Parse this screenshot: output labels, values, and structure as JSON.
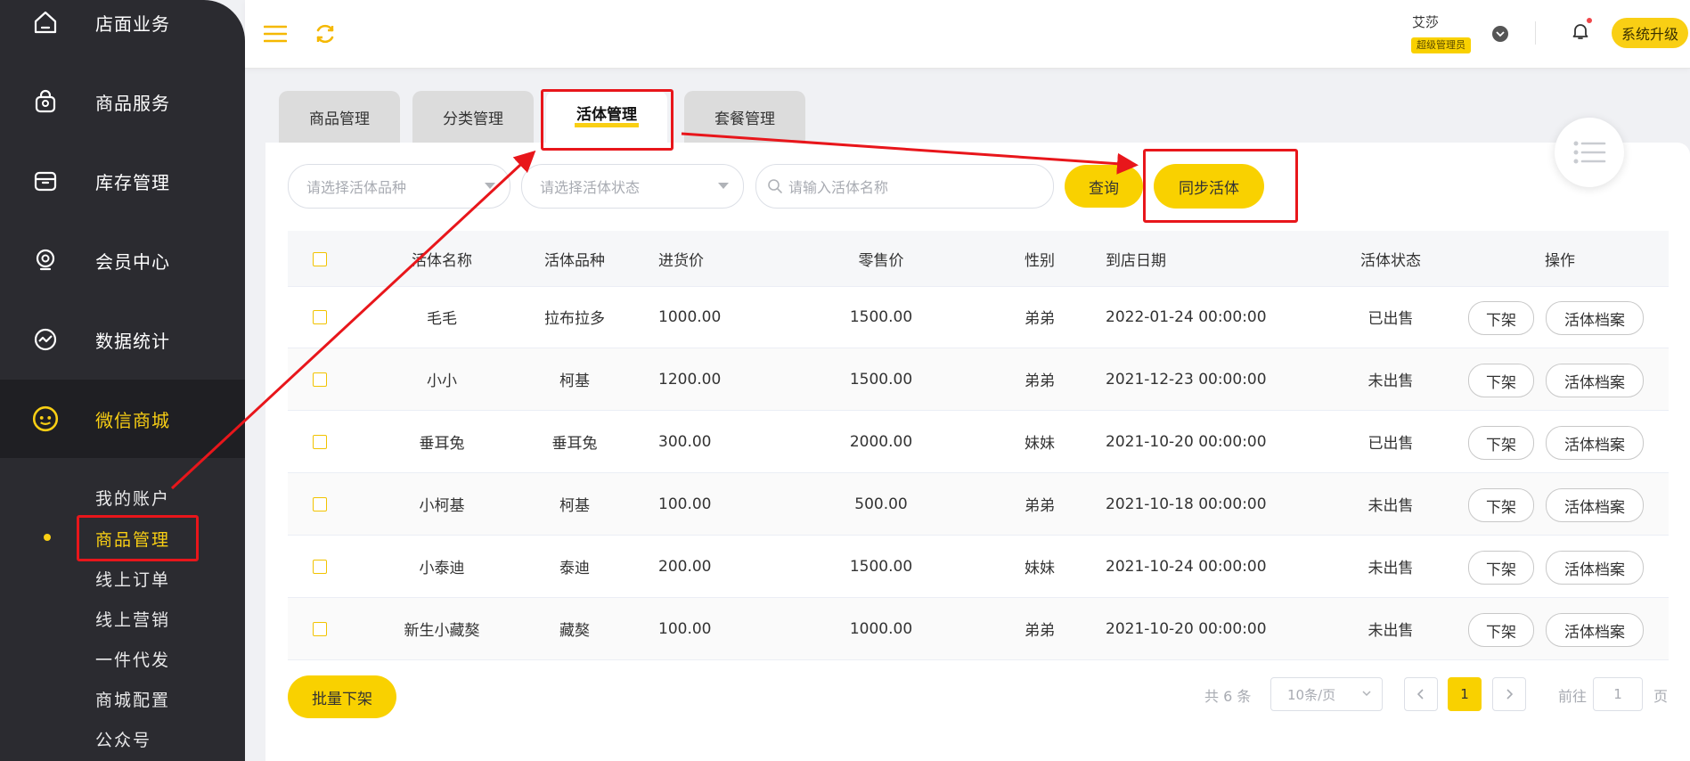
{
  "sidebar": {
    "items": [
      {
        "label": "店面业务",
        "icon": "home-icon"
      },
      {
        "label": "商品服务",
        "icon": "shopping-bag-icon"
      },
      {
        "label": "库存管理",
        "icon": "inventory-box-icon"
      },
      {
        "label": "会员中心",
        "icon": "member-icon"
      },
      {
        "label": "数据统计",
        "icon": "chart-icon"
      },
      {
        "label": "微信商城",
        "icon": "wechat-icon"
      }
    ],
    "sub_items": [
      "我的账户",
      "商品管理",
      "线上订单",
      "线上营销",
      "一件代发",
      "商城配置",
      "公众号"
    ]
  },
  "header": {
    "user_name": "艾莎",
    "user_role": "超级管理员",
    "upgrade_label": "系统升级"
  },
  "tabs": [
    "商品管理",
    "分类管理",
    "活体管理",
    "套餐管理"
  ],
  "filters": {
    "breed_placeholder": "请选择活体品种",
    "status_placeholder": "请选择活体状态",
    "name_placeholder": "请输入活体名称",
    "query_label": "查询",
    "sync_label": "同步活体"
  },
  "table": {
    "columns": [
      "活体名称",
      "活体品种",
      "进货价",
      "零售价",
      "性别",
      "到店日期",
      "活体状态",
      "操作"
    ],
    "rows": [
      {
        "name": "毛毛",
        "breed": "拉布拉多",
        "cost": "1000.00",
        "price": "1500.00",
        "gender": "弟弟",
        "date": "2022-01-24 00:00:00",
        "status": "已出售"
      },
      {
        "name": "小小",
        "breed": "柯基",
        "cost": "1200.00",
        "price": "1500.00",
        "gender": "弟弟",
        "date": "2021-12-23 00:00:00",
        "status": "未出售"
      },
      {
        "name": "垂耳兔",
        "breed": "垂耳兔",
        "cost": "300.00",
        "price": "2000.00",
        "gender": "妹妹",
        "date": "2021-10-20 00:00:00",
        "status": "已出售"
      },
      {
        "name": "小柯基",
        "breed": "柯基",
        "cost": "100.00",
        "price": "500.00",
        "gender": "弟弟",
        "date": "2021-10-18 00:00:00",
        "status": "未出售"
      },
      {
        "name": "小泰迪",
        "breed": "泰迪",
        "cost": "200.00",
        "price": "1500.00",
        "gender": "妹妹",
        "date": "2021-10-24 00:00:00",
        "status": "未出售"
      },
      {
        "name": "新生小藏獒",
        "breed": "藏獒",
        "cost": "100.00",
        "price": "1000.00",
        "gender": "弟弟",
        "date": "2021-10-20 00:00:00",
        "status": "未出售"
      }
    ],
    "op_off_shelf": "下架",
    "op_archive": "活体档案"
  },
  "footer": {
    "batch_label": "批量下架",
    "total_text": "共 6 条",
    "page_size": "10条/页",
    "current_page": "1",
    "goto_label": "前往",
    "goto_value": "1",
    "page_unit": "页"
  },
  "colors": {
    "accent": "#f9cf14",
    "sidebar": "#2b2b30",
    "annotation": "#e8161b"
  }
}
